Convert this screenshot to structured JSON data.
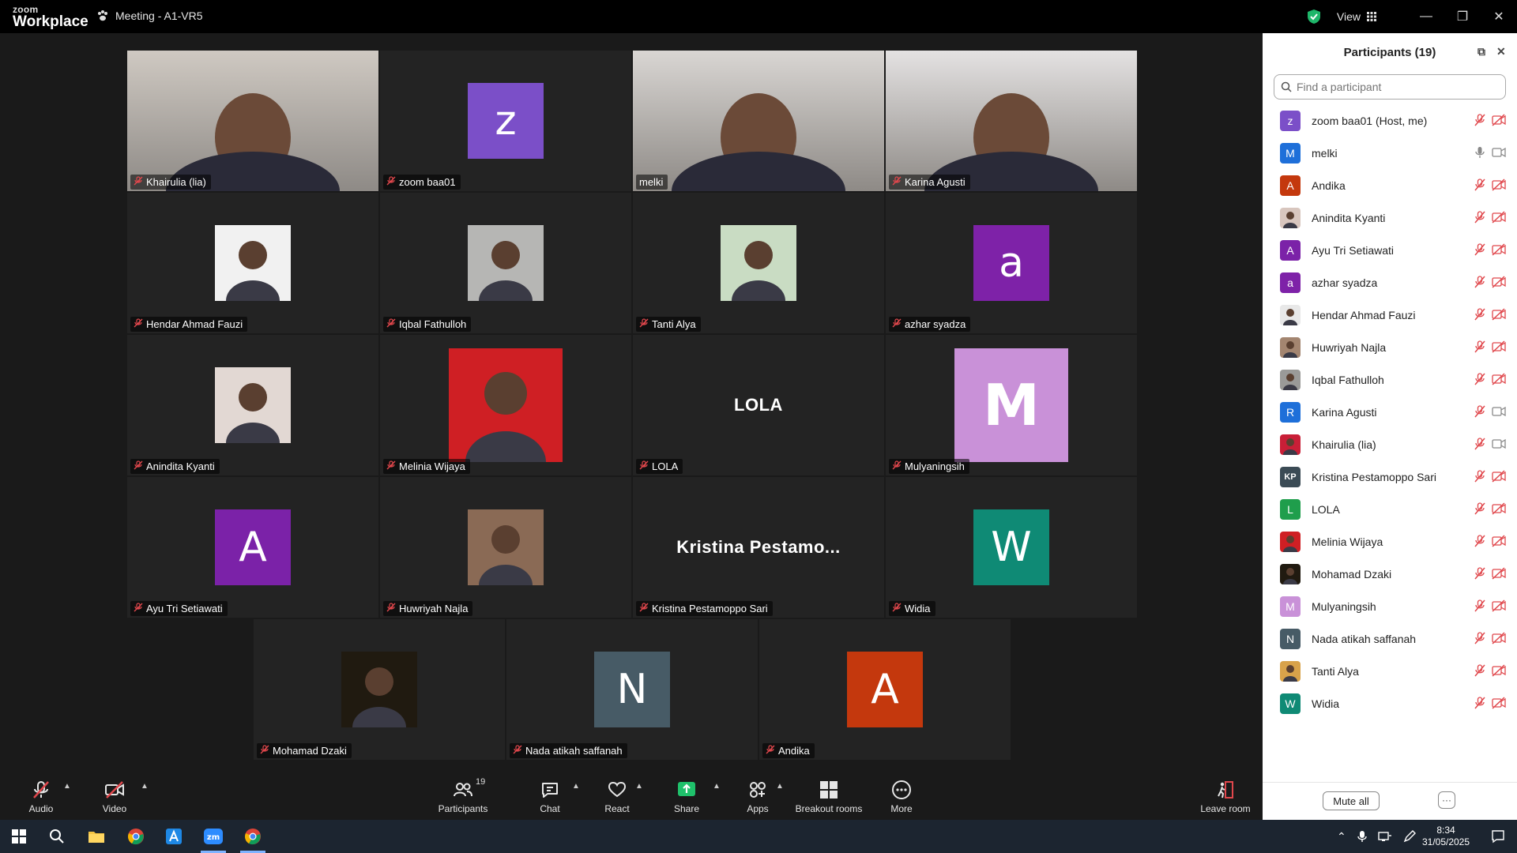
{
  "app": {
    "brand_top": "zoom",
    "brand_bottom": "Workplace",
    "meeting_title": "Meeting - A1-VR5",
    "view_label": "View"
  },
  "tiles": [
    {
      "name": "Khairulia (lia)",
      "kind": "video",
      "color": "#cfc9c2"
    },
    {
      "name": "zoom baa01",
      "kind": "avatar",
      "letter": "z",
      "color": "#7b4fc8"
    },
    {
      "name": "melki",
      "kind": "video",
      "color": "#d9d6d3",
      "active": true
    },
    {
      "name": "Karina Agusti",
      "kind": "video",
      "color": "#e4e2e2"
    },
    {
      "name": "Hendar Ahmad Fauzi",
      "kind": "photo",
      "color": "#f1f1f1"
    },
    {
      "name": "Iqbal Fathulloh",
      "kind": "photo",
      "color": "#b6b6b4"
    },
    {
      "name": "Tanti Alya",
      "kind": "photo",
      "color": "#c9dcc3"
    },
    {
      "name": "azhar syadza",
      "kind": "avatar",
      "letter": "a",
      "color": "#7e22a8"
    },
    {
      "name": "Anindita Kyanti",
      "kind": "photo",
      "color": "#e2d8d3"
    },
    {
      "name": "Melinia Wijaya",
      "kind": "photo-big",
      "color": "#cf1f24"
    },
    {
      "name": "LOLA",
      "kind": "name",
      "display": "LOLA"
    },
    {
      "name": "Mulyaningsih",
      "kind": "avatar-big",
      "letter": "M",
      "color": "#c991d8"
    },
    {
      "name": "Ayu Tri Setiawati",
      "kind": "avatar",
      "letter": "A",
      "color": "#7b22a8"
    },
    {
      "name": "Huwriyah Najla",
      "kind": "photo",
      "color": "#8a6a55"
    },
    {
      "name": "Kristina Pestamoppo Sari",
      "kind": "name",
      "display": "Kristina  Pestamo..."
    },
    {
      "name": "Widia",
      "kind": "avatar",
      "letter": "W",
      "color": "#0f8a75"
    },
    {
      "name": "Mohamad Dzaki",
      "kind": "photo",
      "color": "#201a10"
    },
    {
      "name": "Nada atikah saffanah",
      "kind": "avatar",
      "letter": "N",
      "color": "#475b66"
    },
    {
      "name": "Andika",
      "kind": "avatar",
      "letter": "A",
      "color": "#c4380d"
    }
  ],
  "toolbar": {
    "audio": "Audio",
    "video": "Video",
    "participants": "Participants",
    "participants_count": "19",
    "chat": "Chat",
    "react": "React",
    "share": "Share",
    "apps": "Apps",
    "breakout": "Breakout rooms",
    "more": "More",
    "leave": "Leave room"
  },
  "panel": {
    "title": "Participants (19)",
    "search_placeholder": "Find a participant",
    "mute_all": "Mute all",
    "more": "···",
    "participants": [
      {
        "name": "zoom baa01 (Host, me)",
        "avatar": "z",
        "color": "#7b4fc8",
        "mic": "muted",
        "cam": "off"
      },
      {
        "name": "melki",
        "avatar": "M",
        "color": "#1e6fd9",
        "mic": "on",
        "cam": "on"
      },
      {
        "name": "Andika",
        "avatar": "A",
        "color": "#c4380d",
        "mic": "muted",
        "cam": "off"
      },
      {
        "name": "Anindita Kyanti",
        "avatar": "",
        "color": "#d8c6be",
        "mic": "muted",
        "cam": "off"
      },
      {
        "name": "Ayu Tri Setiawati",
        "avatar": "A",
        "color": "#7b22a8",
        "mic": "muted",
        "cam": "off"
      },
      {
        "name": "azhar syadza",
        "avatar": "a",
        "color": "#7e22a8",
        "mic": "muted",
        "cam": "off"
      },
      {
        "name": "Hendar Ahmad Fauzi",
        "avatar": "",
        "color": "#e8e8e8",
        "mic": "muted",
        "cam": "off"
      },
      {
        "name": "Huwriyah Najla",
        "avatar": "",
        "color": "#a38570",
        "mic": "muted",
        "cam": "off"
      },
      {
        "name": "Iqbal Fathulloh",
        "avatar": "",
        "color": "#9a9a98",
        "mic": "muted",
        "cam": "off"
      },
      {
        "name": "Karina Agusti",
        "avatar": "R",
        "color": "#1e6fd9",
        "mic": "muted",
        "cam": "on"
      },
      {
        "name": "Khairulia (lia)",
        "avatar": "",
        "color": "#c91f37",
        "mic": "muted",
        "cam": "on"
      },
      {
        "name": "Kristina Pestamoppo Sari",
        "avatar": "KP",
        "color": "#3b4b55",
        "mic": "muted",
        "cam": "off"
      },
      {
        "name": "LOLA",
        "avatar": "L",
        "color": "#1f9e4c",
        "mic": "muted",
        "cam": "off"
      },
      {
        "name": "Melinia Wijaya",
        "avatar": "",
        "color": "#cf1f24",
        "mic": "muted",
        "cam": "off"
      },
      {
        "name": "Mohamad Dzaki",
        "avatar": "",
        "color": "#201a10",
        "mic": "muted",
        "cam": "off"
      },
      {
        "name": "Mulyaningsih",
        "avatar": "M",
        "color": "#c991d8",
        "mic": "muted",
        "cam": "off"
      },
      {
        "name": "Nada atikah saffanah",
        "avatar": "N",
        "color": "#475b66",
        "mic": "muted",
        "cam": "off"
      },
      {
        "name": "Tanti Alya",
        "avatar": "",
        "color": "#d8a24a",
        "mic": "muted",
        "cam": "off"
      },
      {
        "name": "Widia",
        "avatar": "W",
        "color": "#0f8a75",
        "mic": "muted",
        "cam": "off"
      }
    ]
  },
  "taskbar": {
    "time": "8:34",
    "date": "31/05/2025"
  },
  "colors": {
    "accent_green": "#2ed38f",
    "muted_red": "#e0474c",
    "share_green": "#1fc16b"
  }
}
